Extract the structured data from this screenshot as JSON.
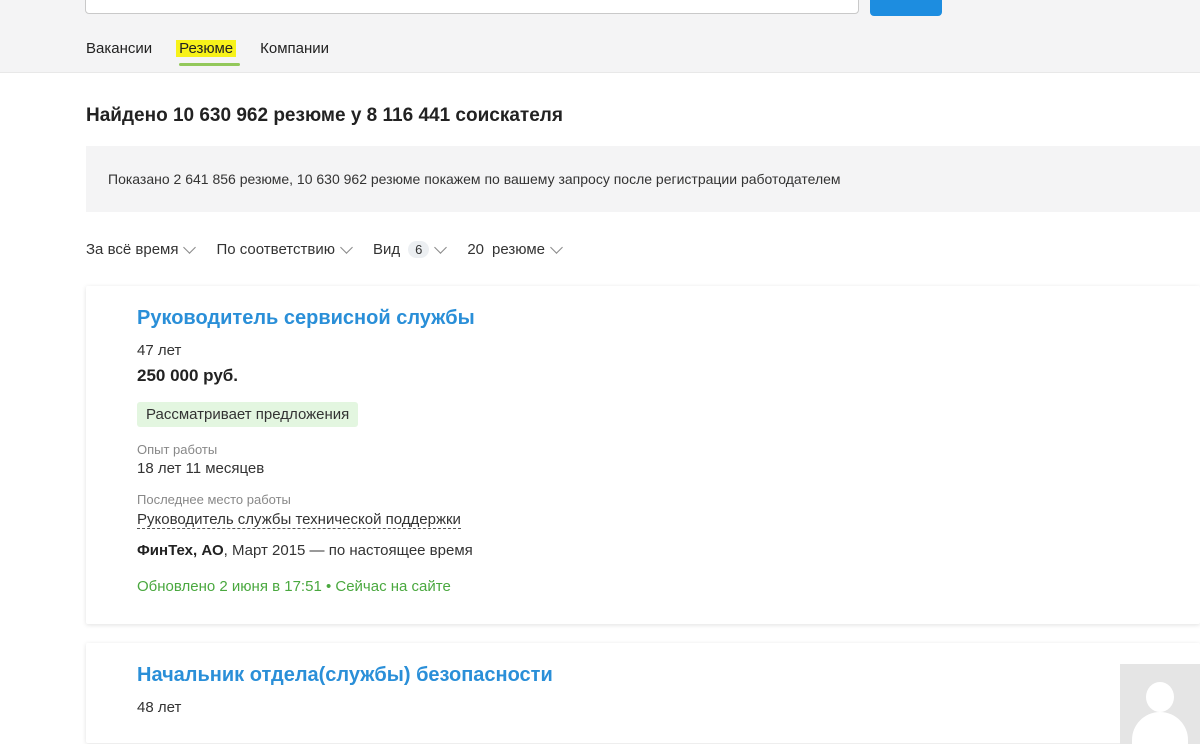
{
  "search": {
    "placeholder": ""
  },
  "nav": {
    "tabs": [
      {
        "label": "Вакансии",
        "active": false
      },
      {
        "label": "Резюме",
        "active": true
      },
      {
        "label": "Компании",
        "active": false
      }
    ]
  },
  "results": {
    "title": "Найдено 10 630 962 резюме у 8 116 441 соискателя",
    "banner": "Показано 2 641 856 резюме, 10 630 962 резюме покажем по вашему запросу после регистрации работодателем"
  },
  "filters": {
    "period": "За всё время",
    "sort": "По соответствию",
    "view_label": "Вид",
    "view_count": "6",
    "per_page_count": "20",
    "per_page_label": "резюме"
  },
  "resumes": [
    {
      "title": "Руководитель сервисной службы",
      "age": "47 лет",
      "salary": "250 000 руб.",
      "status": "Рассматривает предложения",
      "experience_label": "Опыт работы",
      "experience": "18 лет 11 месяцев",
      "last_job_label": "Последнее место работы",
      "last_job_position": "Руководитель службы технической поддержки",
      "last_job_company": "ФинТех, АО",
      "last_job_period": ", Март 2015 — по настоящее время",
      "updated": "Обновлено 2 июня в 17:51 • Сейчас на сайте"
    },
    {
      "title": "Начальник отдела(службы) безопасности",
      "age": "48 лет",
      "avatar_icon": "user-placeholder-icon"
    }
  ],
  "colors": {
    "accent_blue": "#2a8fd8",
    "button_blue": "#1d8de0",
    "status_green_bg": "#e3f6e0",
    "online_green": "#4aa83f",
    "highlight_yellow": "#f7f21a"
  }
}
